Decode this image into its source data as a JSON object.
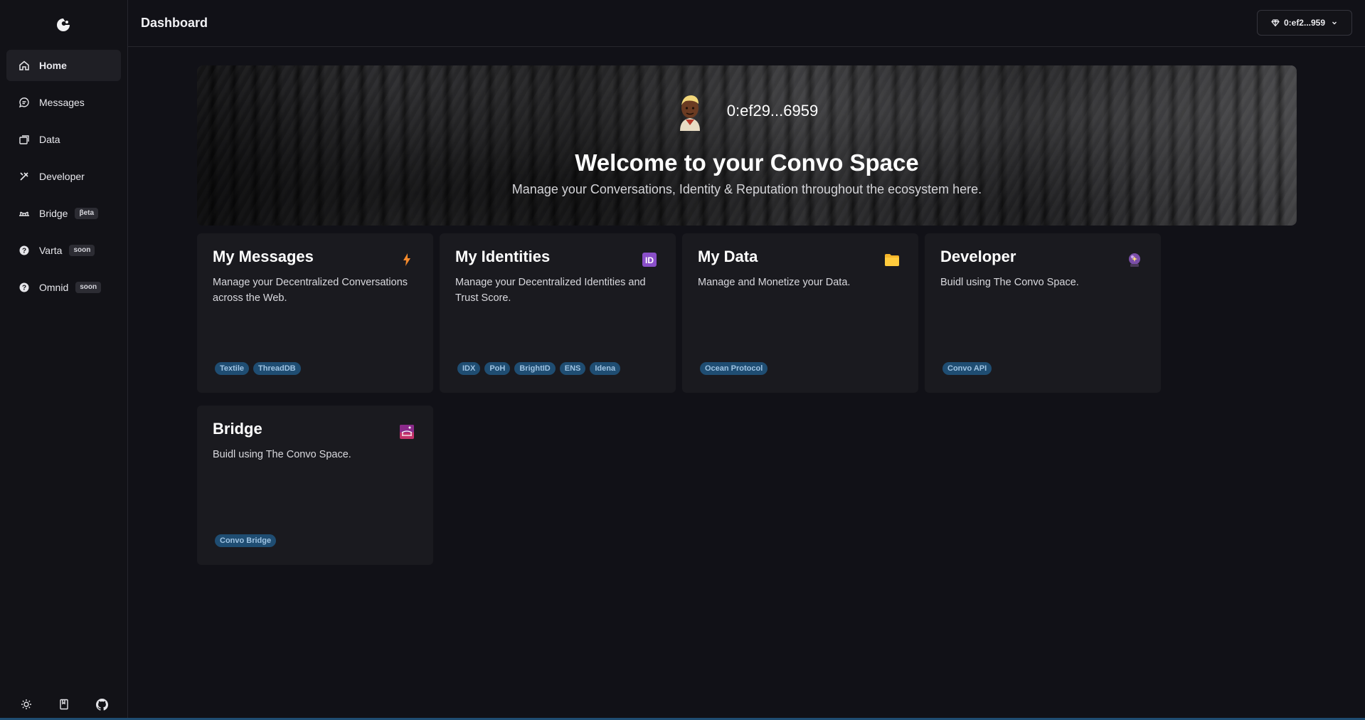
{
  "header": {
    "title": "Dashboard",
    "wallet": "0:ef2...959"
  },
  "sidebar": {
    "items": [
      {
        "label": "Home",
        "icon": "home-icon",
        "active": true
      },
      {
        "label": "Messages",
        "icon": "messages-icon"
      },
      {
        "label": "Data",
        "icon": "data-icon"
      },
      {
        "label": "Developer",
        "icon": "tools-icon"
      },
      {
        "label": "Bridge",
        "icon": "bridge-icon",
        "badge": "βeta"
      },
      {
        "label": "Varta",
        "icon": "help-icon",
        "badge": "soon"
      },
      {
        "label": "Omnid",
        "icon": "help-icon",
        "badge": "soon"
      }
    ],
    "bottom": [
      "sun-icon",
      "book-icon",
      "github-icon"
    ]
  },
  "hero": {
    "address": "0:ef29...6959",
    "title": "Welcome to your Convo Space",
    "subtitle": "Manage your Conversations, Identity & Reputation throughout the ecosystem here."
  },
  "cards": [
    {
      "title": "My Messages",
      "desc": "Manage your Decentralized Conversations across the Web.",
      "tags": [
        "Textile",
        "ThreadDB"
      ],
      "icon": "lightning-icon"
    },
    {
      "title": "My Identities",
      "desc": "Manage your Decentralized Identities and Trust Score.",
      "tags": [
        "IDX",
        "PoH",
        "BrightID",
        "ENS",
        "Idena"
      ],
      "icon": "id-icon"
    },
    {
      "title": "My Data",
      "desc": "Manage and Monetize your Data.",
      "tags": [
        "Ocean Protocol"
      ],
      "icon": "folder-icon"
    },
    {
      "title": "Developer",
      "desc": "Buidl using The Convo Space.",
      "tags": [
        "Convo API"
      ],
      "icon": "crystal-ball-icon"
    },
    {
      "title": "Bridge",
      "desc": "Buidl using The Convo Space.",
      "tags": [
        "Convo Bridge"
      ],
      "icon": "railway-icon"
    }
  ],
  "colors": {
    "background": "#111117",
    "card": "#1a1a1f",
    "tag_bg": "#1f4d72",
    "tag_text": "#9fc3e2"
  }
}
